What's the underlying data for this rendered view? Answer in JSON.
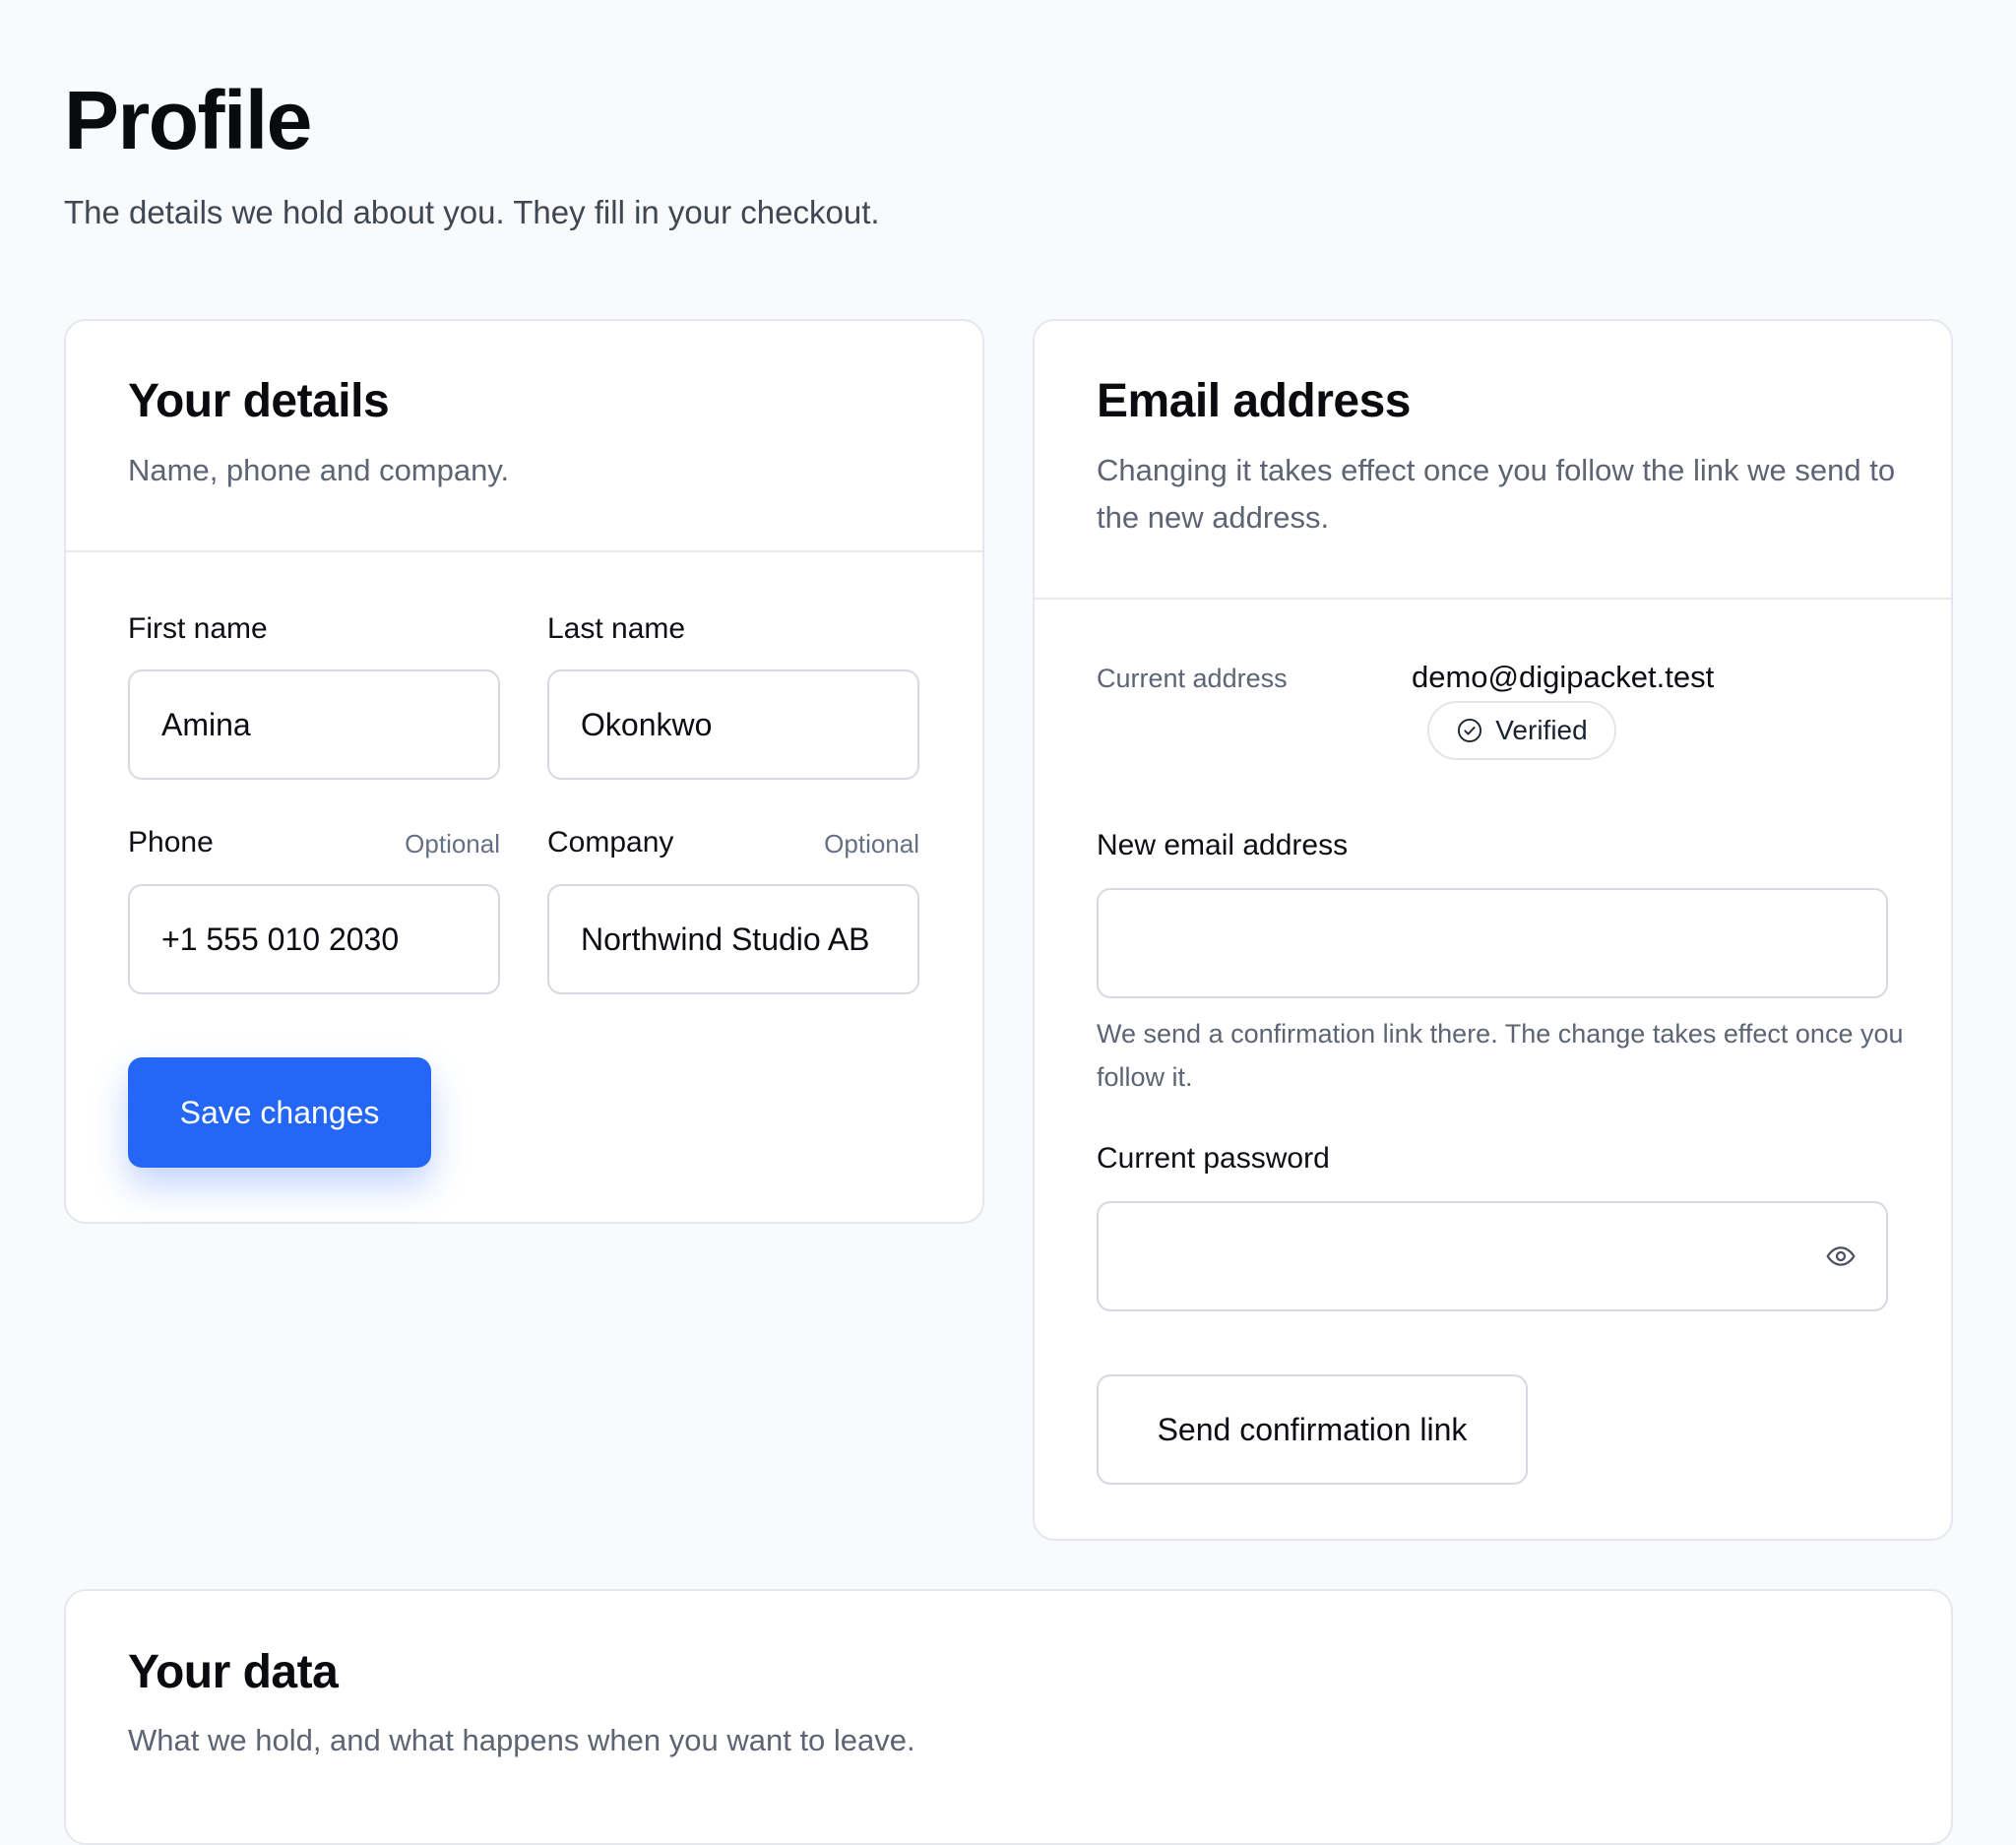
{
  "page": {
    "title": "Profile",
    "subtitle": "The details we hold about you. They fill in your checkout."
  },
  "details_card": {
    "title": "Your details",
    "description": "Name, phone and company.",
    "first_name": {
      "label": "First name",
      "value": "Amina"
    },
    "last_name": {
      "label": "Last name",
      "value": "Okonkwo"
    },
    "phone": {
      "label": "Phone",
      "tag": "Optional",
      "value": "+1 555 010 2030"
    },
    "company": {
      "label": "Company",
      "tag": "Optional",
      "value": "Northwind Studio AB"
    },
    "save_label": "Save changes",
    "accent_color": "#2466f5"
  },
  "email_card": {
    "title": "Email address",
    "description": "Changing it takes effect once you follow the link we send to the new address.",
    "current_label": "Current address",
    "current_email": "demo@digipacket.test",
    "verified_label": "Verified",
    "verified_icon": "check-circle-icon",
    "new_email": {
      "label": "New email address",
      "value": ""
    },
    "new_email_help": "We send a confirmation link there. The change takes effect once you follow it.",
    "password": {
      "label": "Current password",
      "value": ""
    },
    "password_toggle_icon": "eye-icon",
    "send_label": "Send confirmation link"
  },
  "data_card": {
    "title": "Your data",
    "description": "What we hold, and what happens when you want to leave."
  }
}
